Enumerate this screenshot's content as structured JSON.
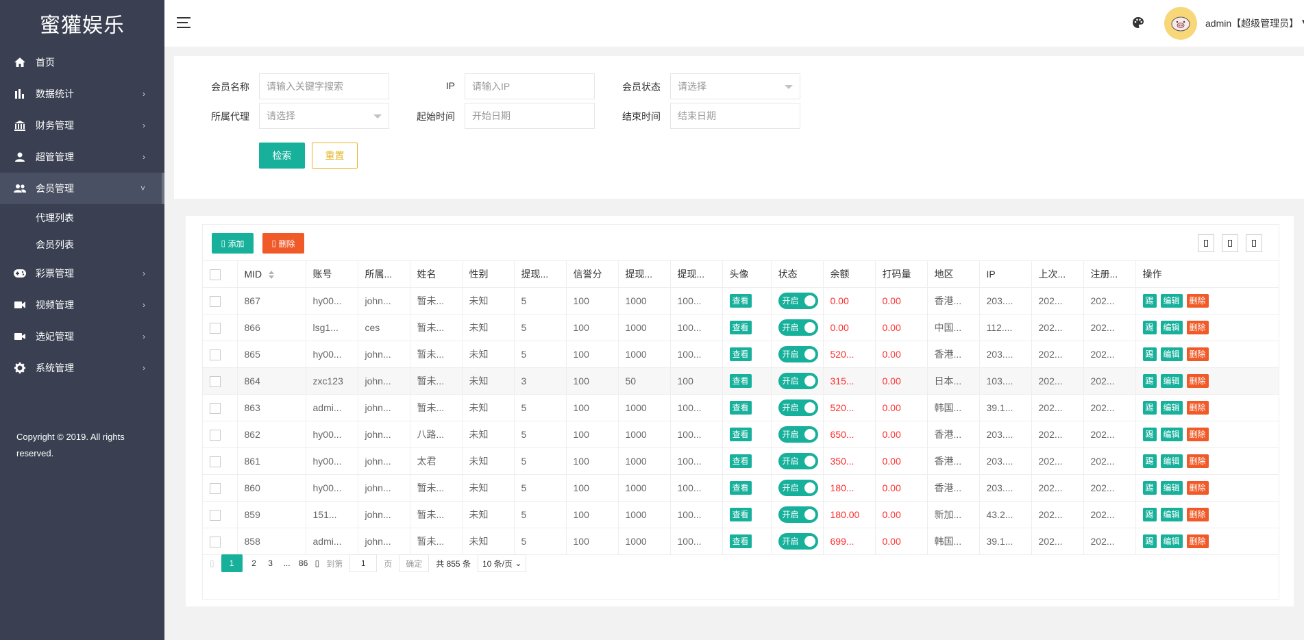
{
  "app_title": "蜜獾娱乐",
  "sidebar": {
    "items": [
      {
        "label": "首页",
        "icon": "home-icon",
        "has_arrow": false
      },
      {
        "label": "数据统计",
        "icon": "bar-chart-icon",
        "has_arrow": true
      },
      {
        "label": "财务管理",
        "icon": "bank-icon",
        "has_arrow": true
      },
      {
        "label": "超管管理",
        "icon": "user-icon",
        "has_arrow": true
      },
      {
        "label": "会员管理",
        "icon": "users-icon",
        "has_arrow": true,
        "active": true
      },
      {
        "label": "彩票管理",
        "icon": "gamepad-icon",
        "has_arrow": true
      },
      {
        "label": "视频管理",
        "icon": "video-icon",
        "has_arrow": true
      },
      {
        "label": "选妃管理",
        "icon": "camera-icon",
        "has_arrow": true
      },
      {
        "label": "系统管理",
        "icon": "gear-icon",
        "has_arrow": true
      }
    ],
    "sub_items": [
      "代理列表",
      "会员列表"
    ],
    "copyright": "Copyright © 2019. All rights reserved."
  },
  "header": {
    "user_name": "admin【超级管理员】"
  },
  "search": {
    "member_name_label": "会员名称",
    "member_name_placeholder": "请输入关键字搜索",
    "ip_label": "IP",
    "ip_placeholder": "请输入IP",
    "status_label": "会员状态",
    "status_placeholder": "请选择",
    "agent_label": "所属代理",
    "agent_placeholder": "请选择",
    "start_label": "起始时间",
    "start_placeholder": "开始日期",
    "end_label": "结束时间",
    "end_placeholder": "结束日期",
    "search_button": "检索",
    "reset_button": "重置"
  },
  "toolbar": {
    "add_label": "添加",
    "delete_label": "删除"
  },
  "table": {
    "headers": [
      "MID",
      "账号",
      "所属...",
      "姓名",
      "性别",
      "提现...",
      "信誉分",
      "提现...",
      "提现...",
      "头像",
      "状态",
      "余额",
      "打码量",
      "地区",
      "IP",
      "上次...",
      "注册...",
      "操作"
    ],
    "view_label": "查看",
    "switch_label": "开启",
    "op_labels": [
      "踢",
      "编辑",
      "删除"
    ],
    "rows": [
      [
        "867",
        "hy00...",
        "john...",
        "暂未...",
        "未知",
        "5",
        "100",
        "1000",
        "100...",
        "0.00",
        "0.00",
        "香港...",
        "203....",
        "202...",
        "202..."
      ],
      [
        "866",
        "lsg1...",
        "ces",
        "暂未...",
        "未知",
        "5",
        "100",
        "1000",
        "100...",
        "0.00",
        "0.00",
        "中国...",
        "112....",
        "202...",
        "202..."
      ],
      [
        "865",
        "hy00...",
        "john...",
        "暂未...",
        "未知",
        "5",
        "100",
        "1000",
        "100...",
        "520...",
        "0.00",
        "香港...",
        "203....",
        "202...",
        "202..."
      ],
      [
        "864",
        "zxc123",
        "john...",
        "暂未...",
        "未知",
        "3",
        "100",
        "50",
        "100",
        "315...",
        "0.00",
        "日本...",
        "103....",
        "202...",
        "202..."
      ],
      [
        "863",
        "admi...",
        "john...",
        "暂未...",
        "未知",
        "5",
        "100",
        "1000",
        "100...",
        "520...",
        "0.00",
        "韩国...",
        "39.1...",
        "202...",
        "202..."
      ],
      [
        "862",
        "hy00...",
        "john...",
        "八路...",
        "未知",
        "5",
        "100",
        "1000",
        "100...",
        "650...",
        "0.00",
        "香港...",
        "203....",
        "202...",
        "202..."
      ],
      [
        "861",
        "hy00...",
        "john...",
        "太君",
        "未知",
        "5",
        "100",
        "1000",
        "100...",
        "350...",
        "0.00",
        "香港...",
        "203....",
        "202...",
        "202..."
      ],
      [
        "860",
        "hy00...",
        "john...",
        "暂未...",
        "未知",
        "5",
        "100",
        "1000",
        "100...",
        "180...",
        "0.00",
        "香港...",
        "203....",
        "202...",
        "202..."
      ],
      [
        "859",
        "151...",
        "john...",
        "暂未...",
        "未知",
        "5",
        "100",
        "1000",
        "100...",
        "180.00",
        "0.00",
        "新加...",
        "43.2...",
        "202...",
        "202..."
      ],
      [
        "858",
        "admi...",
        "john...",
        "暂未...",
        "未知",
        "5",
        "100",
        "1000",
        "100...",
        "699...",
        "0.00",
        "韩国...",
        "39.1...",
        "202...",
        "202..."
      ]
    ]
  },
  "pager": {
    "pages": [
      "1",
      "2",
      "3"
    ],
    "ellipsis": "...",
    "last_page": "86",
    "goto_label": "到第",
    "goto_value": "1",
    "page_unit": "页",
    "confirm_label": "确定",
    "total_label": "共 855 条",
    "page_size_label": "10 条/页"
  },
  "colors": {
    "sidebar_bg": "#3a4052",
    "accent": "#16b09b",
    "danger": "#f05a28",
    "warning": "#e6b422"
  }
}
